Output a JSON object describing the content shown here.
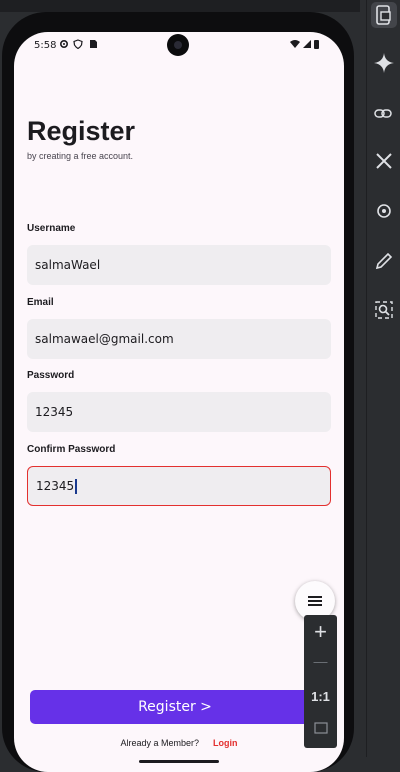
{
  "status": {
    "time": "5:58"
  },
  "register": {
    "title": "Register",
    "subtitle": "by creating a free account.",
    "fields": [
      {
        "label": "Username",
        "value": "salmaWael"
      },
      {
        "label": "Email",
        "value": "salmawael@gmail.com"
      },
      {
        "label": "Password",
        "value": "12345"
      },
      {
        "label": "Confirm Password",
        "value": "12345"
      }
    ],
    "button_label": "Register >",
    "footer_text": "Already a Member?",
    "login_link": "Login"
  },
  "zoom": {
    "plus": "+",
    "minus": "—",
    "ratio": "1:1"
  },
  "colors": {
    "accent": "#6631e8",
    "error": "#e3302f",
    "background": "#fdf7fb"
  },
  "icons": [
    "settings-icon",
    "shield-icon",
    "sim-icon",
    "wifi-icon",
    "battery-icon",
    "device-manager-icon",
    "gemini-icon",
    "link-icon",
    "tools-icon",
    "settings-edit-icon",
    "pencil-icon",
    "inspect-icon",
    "menu-icon"
  ]
}
